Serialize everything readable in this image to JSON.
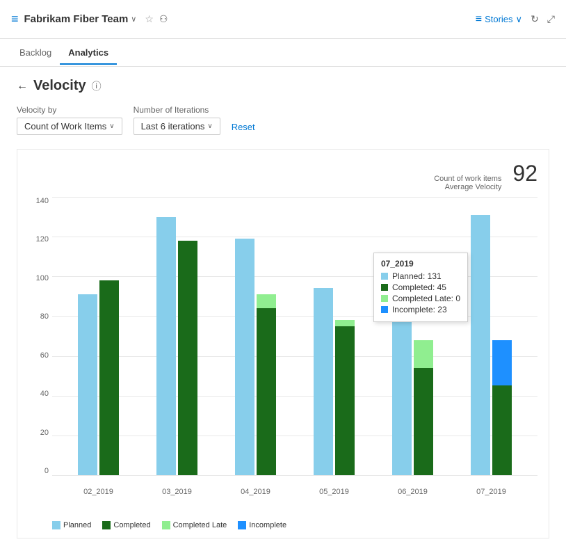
{
  "header": {
    "icon": "≡",
    "team_name": "Fabrikam Fiber Team",
    "chevron": "∨",
    "star": "☆",
    "people": "⚇",
    "stories_label": "Stories",
    "stories_chevron": "∨",
    "refresh_icon": "↻",
    "expand_icon": "⤢"
  },
  "nav": {
    "tabs": [
      {
        "id": "backlog",
        "label": "Backlog",
        "active": false
      },
      {
        "id": "analytics",
        "label": "Analytics",
        "active": true
      }
    ]
  },
  "page": {
    "back_icon": "←",
    "title": "Velocity",
    "help_icon": "ⓘ"
  },
  "filters": {
    "velocity_by_label": "Velocity by",
    "velocity_by_value": "Count of Work Items",
    "iterations_label": "Number of Iterations",
    "iterations_value": "Last 6 iterations",
    "reset_label": "Reset"
  },
  "chart": {
    "metric_label": "Count of work items",
    "avg_label": "Average Velocity",
    "avg_value": "92",
    "y_labels": [
      "0",
      "20",
      "40",
      "60",
      "80",
      "100",
      "120",
      "140"
    ],
    "x_labels": [
      "02_2019",
      "03_2019",
      "04_2019",
      "05_2019",
      "06_2019",
      "07_2019"
    ],
    "colors": {
      "planned": "#87CEEB",
      "completed": "#1a6b1a",
      "completed_late": "#90EE90",
      "incomplete": "#1e90ff"
    },
    "bars": [
      {
        "sprint": "02_2019",
        "planned": 91,
        "completed": 98,
        "completed_late": 0,
        "incomplete": 0
      },
      {
        "sprint": "03_2019",
        "planned": 130,
        "completed": 118,
        "completed_late": 0,
        "incomplete": 0
      },
      {
        "sprint": "04_2019",
        "planned": 119,
        "completed": 84,
        "completed_late": 7,
        "incomplete": 0
      },
      {
        "sprint": "05_2019",
        "planned": 94,
        "completed": 75,
        "completed_late": 3,
        "incomplete": 0
      },
      {
        "sprint": "06_2019",
        "planned": 91,
        "completed": 54,
        "completed_late": 14,
        "incomplete": 0
      },
      {
        "sprint": "07_2019",
        "planned": 131,
        "completed": 45,
        "completed_late": 0,
        "incomplete": 23
      }
    ],
    "tooltip": {
      "title": "07_2019",
      "rows": [
        {
          "color": "#87CEEB",
          "label": "Planned: 131"
        },
        {
          "color": "#1a6b1a",
          "label": "Completed: 45"
        },
        {
          "color": "#90EE90",
          "label": "Completed Late: 0"
        },
        {
          "color": "#1e90ff",
          "label": "Incomplete: 23"
        }
      ]
    },
    "legend": [
      {
        "color": "#87CEEB",
        "label": "Planned"
      },
      {
        "color": "#1a6b1a",
        "label": "Completed"
      },
      {
        "color": "#90EE90",
        "label": "Completed Late"
      },
      {
        "color": "#1e90ff",
        "label": "Incomplete"
      }
    ]
  }
}
